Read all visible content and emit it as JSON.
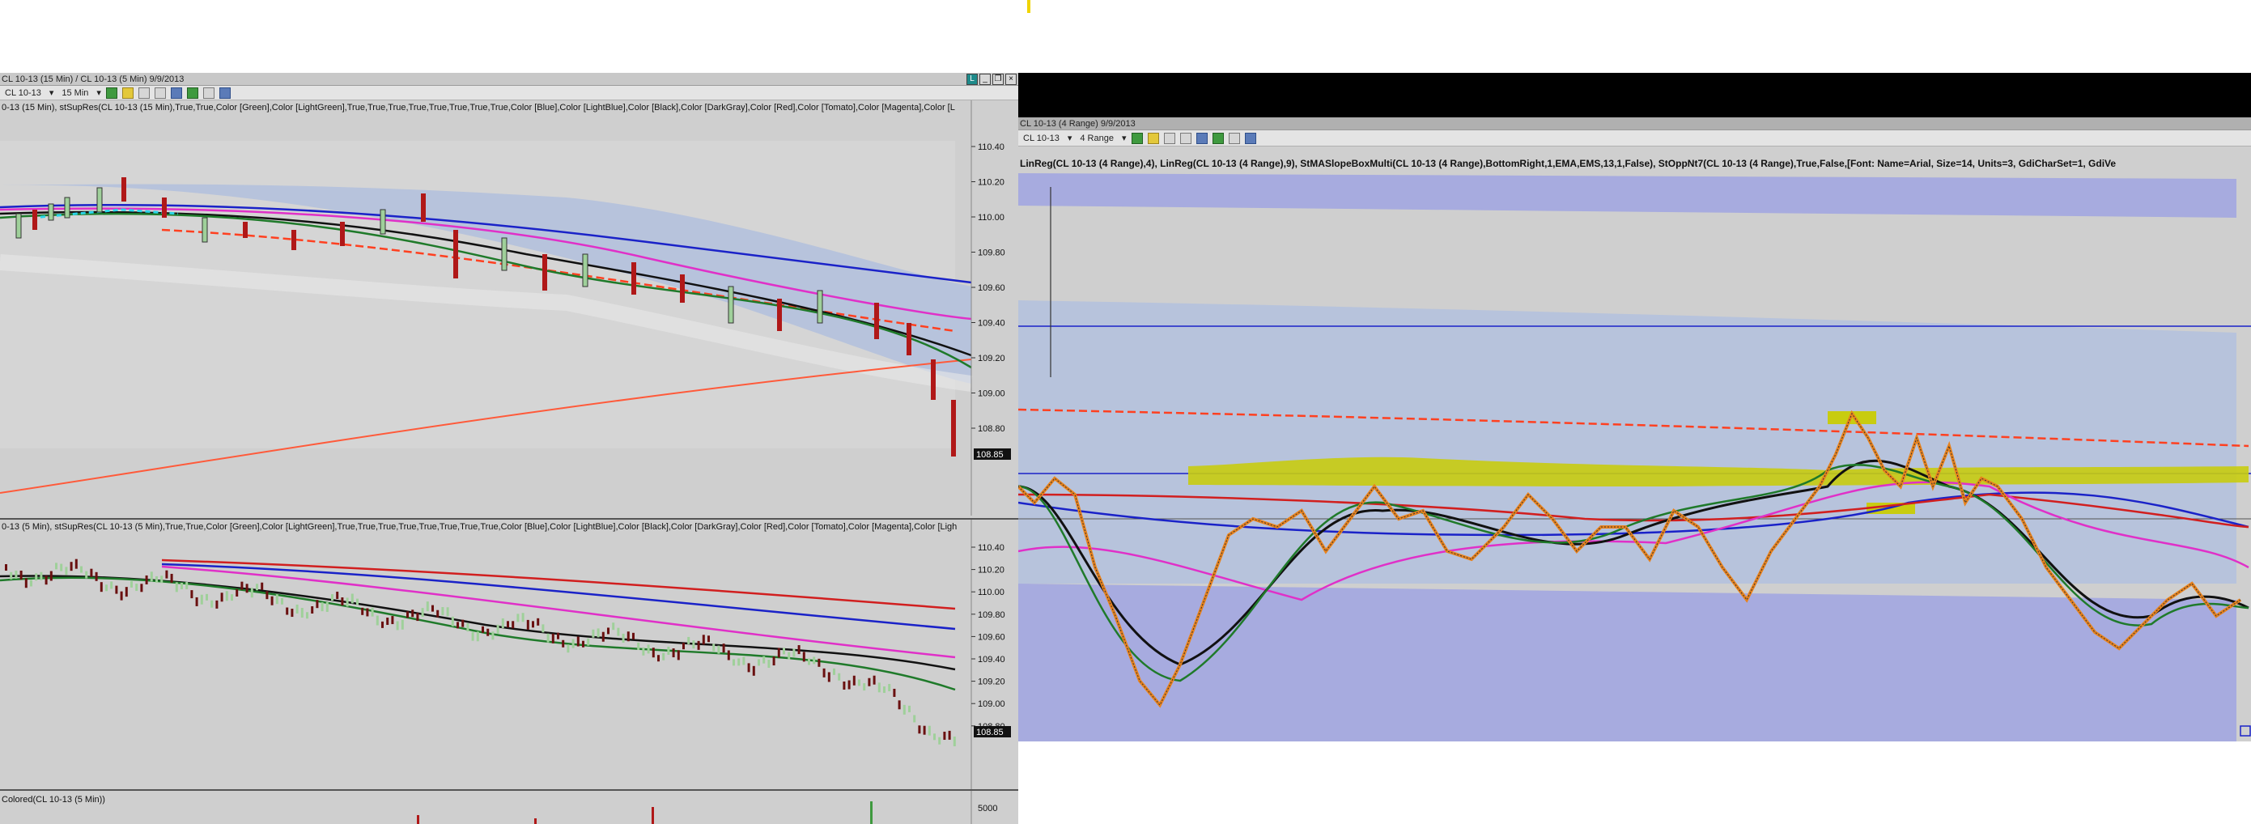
{
  "left": {
    "title": "CL 10-13 (15 Min) / CL 10-13 (5 Min)  9/9/2013",
    "toolbar": {
      "instrument": "CL 10-13",
      "period": "15 Min"
    },
    "top_panel": {
      "indicator_text": "0-13 (15 Min), stSupRes(CL 10-13 (15 Min),True,True,Color [Green],Color [LightGreen],True,True,True,True,True,True,True,True,Color [Blue],Color [LightBlue],Color [Black],Color [DarkGray],Color [Red],Color [Tomato],Color [Magenta],Color [L",
      "price_ticks": [
        "110.40",
        "110.20",
        "110.00",
        "109.80",
        "109.60",
        "109.40",
        "109.20",
        "109.00",
        "108.80"
      ],
      "last_price": "108.85"
    },
    "mid_panel": {
      "indicator_text": "0-13 (5 Min), stSupRes(CL 10-13 (5 Min),True,True,Color [Green],Color [LightGreen],True,True,True,True,True,True,True,True,Color [Blue],Color [LightBlue],Color [Black],Color [DarkGray],Color [Red],Color [Tomato],Color [Magenta],Color [Ligh",
      "price_ticks": [
        "110.40",
        "110.20",
        "110.00",
        "109.80",
        "109.60",
        "109.40",
        "109.20",
        "109.00",
        "108.80"
      ],
      "last_price": "108.85"
    },
    "volume_panel": {
      "indicator_text": "Colored(CL 10-13 (5 Min))",
      "tick": "5000"
    }
  },
  "right": {
    "title": "CL 10-13 (4 Range)  9/9/2013",
    "toolbar": {
      "instrument": "CL 10-13",
      "period": "4 Range"
    },
    "indicator_text": "LinReg(CL 10-13 (4 Range),4),  LinReg(CL 10-13 (4 Range),9),  StMASlopeBoxMulti(CL 10-13 (4 Range),BottomRight,1,EMA,EMS,13,1,False),  StOppNt7(CL 10-13 (4 Range),True,False,[Font: Name=Arial, Size=14, Units=3, GdiCharSet=1, GdiVe"
  },
  "colors": {
    "chart_bg": "#cfcfcf",
    "band_blue": "#a7abdf",
    "band_light": "#b7c3dc",
    "up_candle": "#9fd09a",
    "down_candle": "#b01818",
    "sma_black": "#111111",
    "ema_green": "#1f7a2a",
    "magenta": "#e030c8",
    "blue": "#1a22c8",
    "red": "#d11f1f",
    "tomato": "#ff5a3a",
    "yellow_zone": "#c8cc10"
  }
}
